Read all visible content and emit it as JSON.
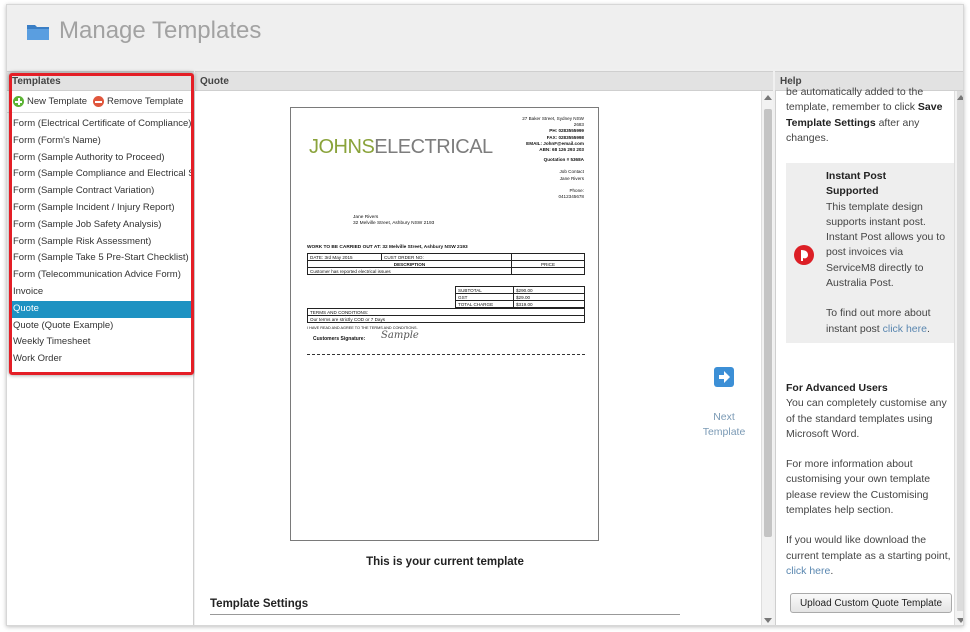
{
  "header": {
    "title": "Manage Templates",
    "icon": "folder-icon",
    "title_color": "#a2a2a2"
  },
  "panels": {
    "templates": "Templates",
    "quote": "Quote",
    "help": "Help"
  },
  "templates_panel": {
    "new_label": "New Template",
    "remove_label": "Remove Template",
    "items": [
      "Form (Electrical Certificate of Compliance)",
      "Form (Form's Name)",
      "Form (Sample Authority to Proceed)",
      "Form (Sample Compliance and Electrical Sa",
      "Form (Sample Contract Variation)",
      "Form (Sample Incident / Injury Report)",
      "Form (Sample Job Safety Analysis)",
      "Form (Sample Risk Assessment)",
      "Form (Sample Take 5 Pre-Start Checklist)",
      "Form (Telecommunication Advice Form)",
      "Invoice",
      "Quote",
      "Quote (Quote Example)",
      "Weekly Timesheet",
      "Work Order"
    ],
    "selected": "Quote",
    "selected_color": "#1e92c2",
    "highlight_color": "#e41e26"
  },
  "center": {
    "current_label": "This is your current template",
    "settings_label": "Template Settings",
    "next_line1": "Next",
    "next_line2": "Template"
  },
  "document": {
    "logo_a": "JOHNS",
    "logo_b": "ELECTRICAL",
    "addr1": "27 Baker Street, Sydney NSW",
    "addr2": "2683",
    "ph": "PH: 0283555999",
    "fax": "FAX: 0283555998",
    "email": "EMAIL: JohnF@email.com",
    "abn": "ABN: 68 126 293 203",
    "quotation": "Quotation # 5368A",
    "job_contact_label": "Job Contact",
    "job_contact": "Jane Rivers",
    "phone_label": "Phone:",
    "phone": "0412345678",
    "client_name": "Jane Rivers",
    "client_addr": "32 Melville Street, Ashbury NSW 2193",
    "work_at": "WORK TO BE CARRIED OUT AT: 32 Melville Street, Ashbury NSW 2193",
    "date": "DATE: 3rd May 2015",
    "order_no": "CUST ORDER NO:",
    "description": "DESCRIPTION",
    "price": "PRICE",
    "item": "Customer has reported electrical issues",
    "subtotal_label": "SUBTOTAL",
    "subtotal": "$290.00",
    "gst_label": "GST",
    "gst": "$29.00",
    "total_label": "TOTAL CHARGE",
    "total": "$319.00",
    "terms_label": "TERMS AND CONDITIONS:",
    "terms": "Our terms are strictly COD or 7 Days",
    "agree": "I HAVE READ AND AGREE TO THE TERMS AND CONDITIONS.",
    "sig_label": "Customers Signature:",
    "sample": "Sample"
  },
  "help": {
    "p0a": "be automatically added to the template, remember to click ",
    "p0b": "Save Template Settings",
    "p0c": " after any changes.",
    "ip_title1": "Instant Post",
    "ip_title2": "Supported",
    "ip_body": "This template design supports instant post. Instant Post allows you to post invoices via ServiceM8 directly to Australia Post.",
    "ip_more": "To find out more about instant post ",
    "ip_link": "click here",
    "adv_title": "For Advanced Users",
    "adv_body": "You can completely customise any of the standard templates using Microsoft Word.",
    "more_body": "For more information about customising your own template please review the Customising templates help section.",
    "dl_body": "If you would like download the current template as a starting point, ",
    "dl_link": "click here",
    "upload_label": "Upload Custom Quote Template"
  }
}
